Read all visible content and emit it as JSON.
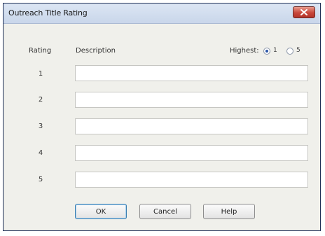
{
  "window": {
    "title": "Outreach Title Rating"
  },
  "headers": {
    "rating": "Rating",
    "description": "Description",
    "highest": "Highest:"
  },
  "highest_options": [
    {
      "label": "1",
      "selected": true
    },
    {
      "label": "5",
      "selected": false
    }
  ],
  "rows": [
    {
      "rating": "1",
      "description": ""
    },
    {
      "rating": "2",
      "description": ""
    },
    {
      "rating": "3",
      "description": ""
    },
    {
      "rating": "4",
      "description": ""
    },
    {
      "rating": "5",
      "description": ""
    }
  ],
  "buttons": {
    "ok": "OK",
    "cancel": "Cancel",
    "help": "Help"
  },
  "icons": {
    "close": "close-x-icon"
  },
  "colors": {
    "titlebar": "#d3dff0",
    "close_button": "#c8473a",
    "dialog_background": "#f0f0eb"
  }
}
